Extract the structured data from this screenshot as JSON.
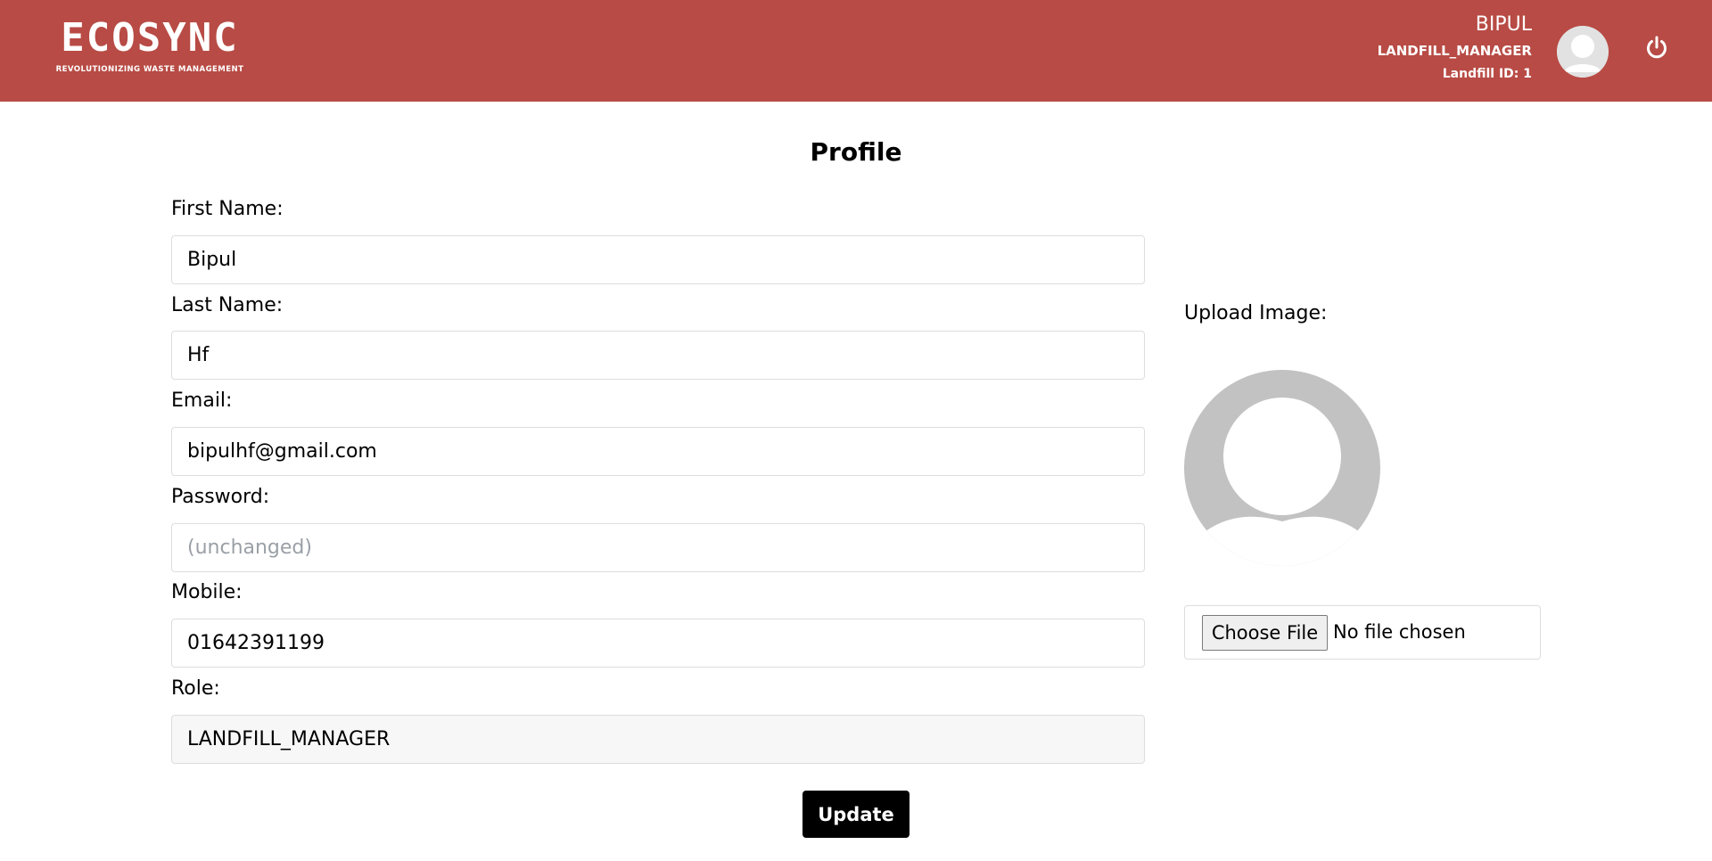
{
  "header": {
    "logo_text": "ECOSYNC",
    "logo_tagline": "REVOLUTIONIZING WASTE MANAGEMENT",
    "user_name": "BIPUL",
    "user_role": "LANDFILL_MANAGER",
    "landfill_id": "Landfill ID: 1",
    "avatar_icon": "user-avatar-icon",
    "logout_icon": "power-icon",
    "background_color": "#b84b45"
  },
  "profile": {
    "title": "Profile",
    "fields": {
      "first_name": {
        "label": "First Name:",
        "value": "Bipul"
      },
      "last_name": {
        "label": "Last Name:",
        "value": "Hf"
      },
      "email": {
        "label": "Email:",
        "value": "bipulhf@gmail.com"
      },
      "password": {
        "label": "Password:",
        "value": "",
        "placeholder": "(unchanged)"
      },
      "mobile": {
        "label": "Mobile:",
        "value": "01642391199"
      },
      "role": {
        "label": "Role:",
        "value": "LANDFILL_MANAGER"
      }
    },
    "upload": {
      "label": "Upload Image:",
      "choose_button": "Choose File",
      "file_status": "No file chosen",
      "preview_icon": "default-avatar-icon"
    },
    "update_button": "Update"
  }
}
